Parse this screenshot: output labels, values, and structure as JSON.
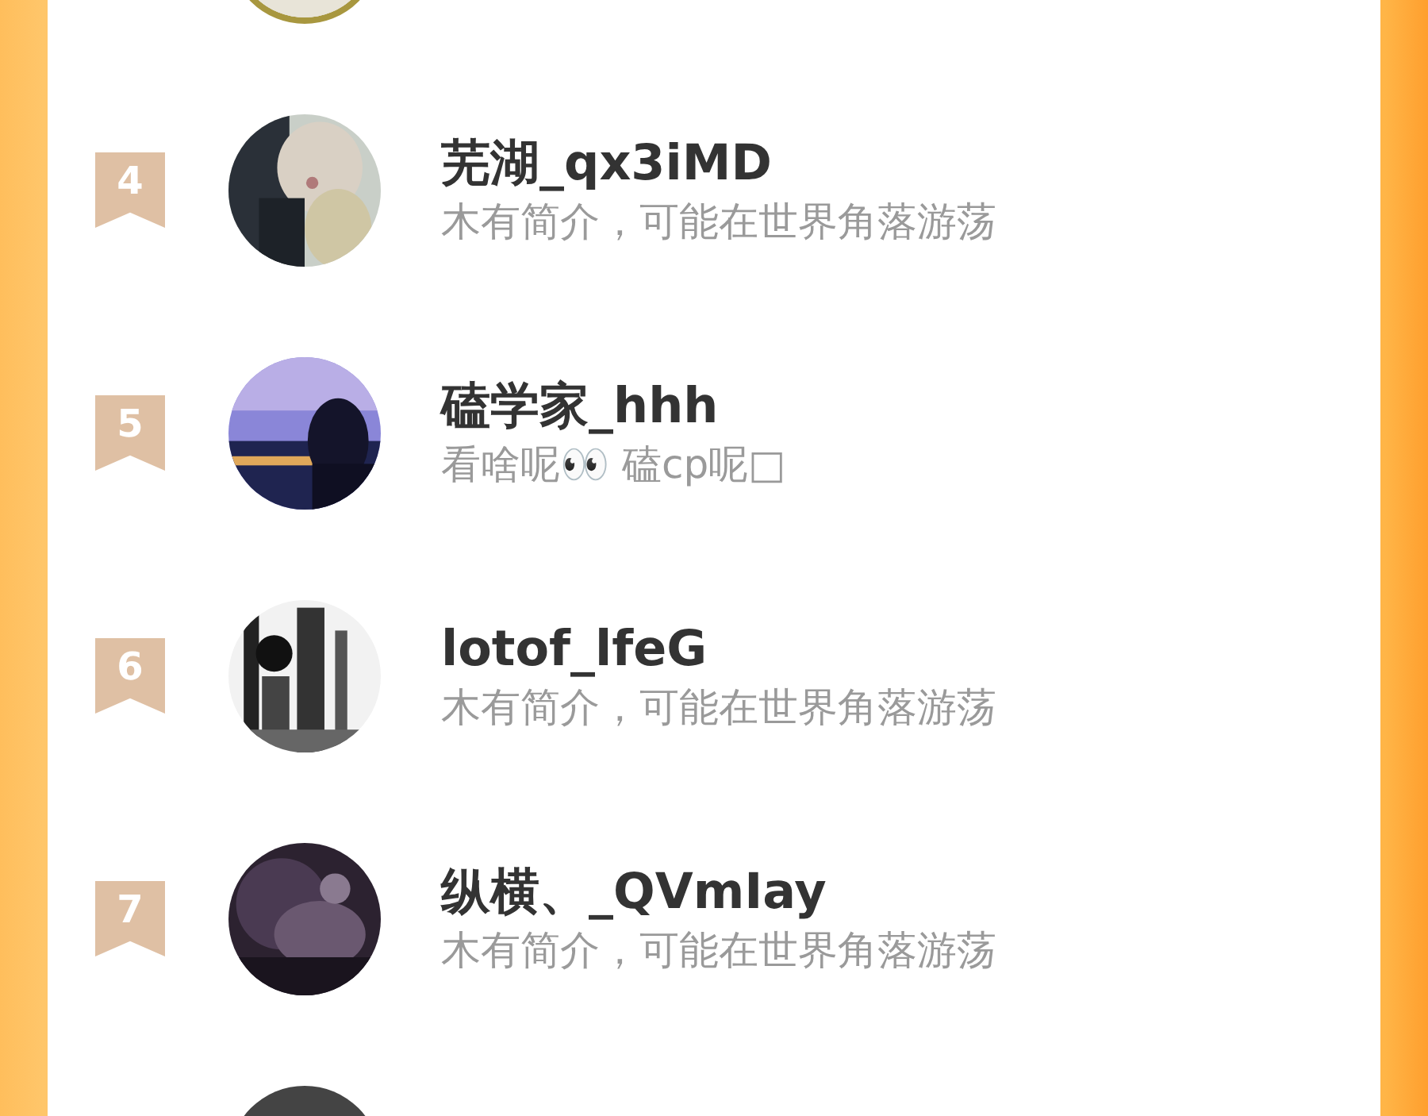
{
  "rows": [
    {
      "kind": "cut",
      "ring": true
    },
    {
      "kind": "full",
      "rank": "4",
      "name": "芜湖_qx3iMD",
      "bio": "木有简介，可能在世界角落游荡"
    },
    {
      "kind": "full",
      "rank": "5",
      "name": "磕学家_hhh",
      "bio": "看啥呢👀 磕cp呢□"
    },
    {
      "kind": "full",
      "rank": "6",
      "name": "lotof_lfeG",
      "bio": "木有简介，可能在世界角落游荡"
    },
    {
      "kind": "full",
      "rank": "7",
      "name": "纵横、_QVmIay",
      "bio": "木有简介，可能在世界角落游荡"
    },
    {
      "kind": "cut"
    }
  ]
}
